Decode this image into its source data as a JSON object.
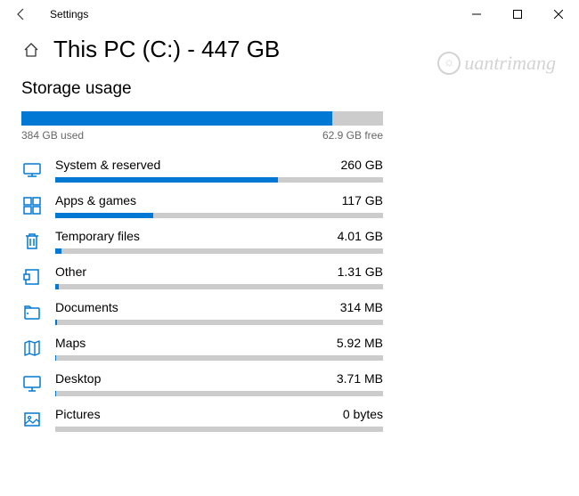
{
  "window": {
    "title": "Settings"
  },
  "header": {
    "page_title": "This PC (C:) - 447 GB"
  },
  "section": {
    "title": "Storage usage",
    "used_label": "384 GB used",
    "free_label": "62.9 GB free",
    "overall_pct": 86
  },
  "categories": [
    {
      "label": "System & reserved",
      "size": "260 GB",
      "pct": 68
    },
    {
      "label": "Apps & games",
      "size": "117 GB",
      "pct": 30
    },
    {
      "label": "Temporary files",
      "size": "4.01 GB",
      "pct": 2
    },
    {
      "label": "Other",
      "size": "1.31 GB",
      "pct": 1
    },
    {
      "label": "Documents",
      "size": "314 MB",
      "pct": 0.5
    },
    {
      "label": "Maps",
      "size": "5.92 MB",
      "pct": 0.3
    },
    {
      "label": "Desktop",
      "size": "3.71 MB",
      "pct": 0.3
    },
    {
      "label": "Pictures",
      "size": "0 bytes",
      "pct": 0
    }
  ],
  "watermark": "uantrimang"
}
